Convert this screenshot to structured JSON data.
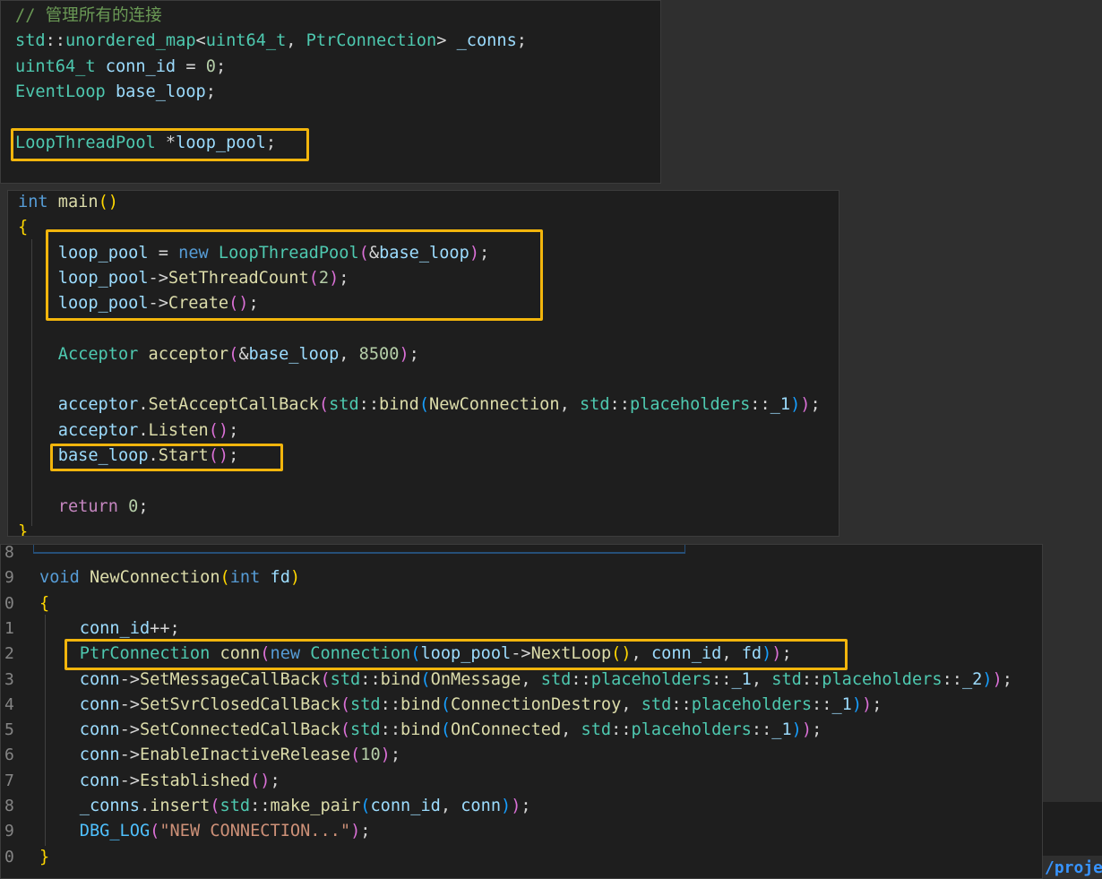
{
  "panel1": {
    "lines": [
      [
        [
          "c-comment",
          "// 管理所有的连接"
        ]
      ],
      [
        [
          "c-type",
          "std"
        ],
        [
          "c-op",
          "::"
        ],
        [
          "c-type",
          "unordered_map"
        ],
        [
          "c-op",
          "<"
        ],
        [
          "c-type",
          "uint64_t"
        ],
        [
          "c-op",
          ", "
        ],
        [
          "c-type",
          "PtrConnection"
        ],
        [
          "c-op",
          "> "
        ],
        [
          "c-var",
          "_conns"
        ],
        [
          "c-op",
          ";"
        ]
      ],
      [
        [
          "c-type",
          "uint64_t"
        ],
        [
          "c-op",
          " "
        ],
        [
          "c-var",
          "conn_id"
        ],
        [
          "c-op",
          " = "
        ],
        [
          "c-num",
          "0"
        ],
        [
          "c-op",
          ";"
        ]
      ],
      [
        [
          "c-type",
          "EventLoop"
        ],
        [
          "c-op",
          " "
        ],
        [
          "c-var",
          "base_loop"
        ],
        [
          "c-op",
          ";"
        ]
      ],
      [],
      [
        [
          "c-type",
          "LoopThreadPool"
        ],
        [
          "c-op",
          " *"
        ],
        [
          "c-var",
          "loop_pool"
        ],
        [
          "c-op",
          ";"
        ]
      ]
    ]
  },
  "panel2": {
    "lines": [
      [
        [
          "c-kw",
          "int"
        ],
        [
          "c-op",
          " "
        ],
        [
          "c-fn",
          "main"
        ],
        [
          "c-p1",
          "()"
        ]
      ],
      [
        [
          "c-p1",
          "{"
        ]
      ],
      [
        [
          "c-op",
          "    "
        ],
        [
          "c-var",
          "loop_pool"
        ],
        [
          "c-op",
          " = "
        ],
        [
          "c-kw",
          "new"
        ],
        [
          "c-op",
          " "
        ],
        [
          "c-type",
          "LoopThreadPool"
        ],
        [
          "c-p2",
          "("
        ],
        [
          "c-op",
          "&"
        ],
        [
          "c-var",
          "base_loop"
        ],
        [
          "c-p2",
          ")"
        ],
        [
          "c-op",
          ";"
        ]
      ],
      [
        [
          "c-op",
          "    "
        ],
        [
          "c-var",
          "loop_pool"
        ],
        [
          "c-op",
          "->"
        ],
        [
          "c-fn",
          "SetThreadCount"
        ],
        [
          "c-p2",
          "("
        ],
        [
          "c-num",
          "2"
        ],
        [
          "c-p2",
          ")"
        ],
        [
          "c-op",
          ";"
        ]
      ],
      [
        [
          "c-op",
          "    "
        ],
        [
          "c-var",
          "loop_pool"
        ],
        [
          "c-op",
          "->"
        ],
        [
          "c-fn",
          "Create"
        ],
        [
          "c-p2",
          "()"
        ],
        [
          "c-op",
          ";"
        ]
      ],
      [],
      [
        [
          "c-op",
          "    "
        ],
        [
          "c-type",
          "Acceptor"
        ],
        [
          "c-op",
          " "
        ],
        [
          "c-fn",
          "acceptor"
        ],
        [
          "c-p2",
          "("
        ],
        [
          "c-op",
          "&"
        ],
        [
          "c-var",
          "base_loop"
        ],
        [
          "c-op",
          ", "
        ],
        [
          "c-num",
          "8500"
        ],
        [
          "c-p2",
          ")"
        ],
        [
          "c-op",
          ";"
        ]
      ],
      [],
      [
        [
          "c-op",
          "    "
        ],
        [
          "c-var",
          "acceptor"
        ],
        [
          "c-op",
          "."
        ],
        [
          "c-fn",
          "SetAcceptCallBack"
        ],
        [
          "c-p2",
          "("
        ],
        [
          "c-type",
          "std"
        ],
        [
          "c-op",
          "::"
        ],
        [
          "c-fn",
          "bind"
        ],
        [
          "c-p3",
          "("
        ],
        [
          "c-fn",
          "NewConnection"
        ],
        [
          "c-op",
          ", "
        ],
        [
          "c-type",
          "std"
        ],
        [
          "c-op",
          "::"
        ],
        [
          "c-type",
          "placeholders"
        ],
        [
          "c-op",
          "::"
        ],
        [
          "c-var",
          "_1"
        ],
        [
          "c-p3",
          ")"
        ],
        [
          "c-p2",
          ")"
        ],
        [
          "c-op",
          ";"
        ]
      ],
      [
        [
          "c-op",
          "    "
        ],
        [
          "c-var",
          "acceptor"
        ],
        [
          "c-op",
          "."
        ],
        [
          "c-fn",
          "Listen"
        ],
        [
          "c-p2",
          "()"
        ],
        [
          "c-op",
          ";"
        ]
      ],
      [
        [
          "c-op",
          "    "
        ],
        [
          "c-var",
          "base_loop"
        ],
        [
          "c-op",
          "."
        ],
        [
          "c-fn",
          "Start"
        ],
        [
          "c-p2",
          "()"
        ],
        [
          "c-op",
          ";"
        ]
      ],
      [],
      [
        [
          "c-op",
          "    "
        ],
        [
          "c-ctl",
          "return"
        ],
        [
          "c-op",
          " "
        ],
        [
          "c-num",
          "0"
        ],
        [
          "c-op",
          ";"
        ]
      ],
      [
        [
          "c-p1",
          "}"
        ]
      ]
    ]
  },
  "panel3": {
    "gutter": [
      "8",
      "9",
      "0",
      "1",
      "2",
      "3",
      "4",
      "5",
      "6",
      "7",
      "8",
      "9",
      "0"
    ],
    "lines": [
      [],
      [
        [
          "c-kw",
          "void"
        ],
        [
          "c-op",
          " "
        ],
        [
          "c-fn",
          "NewConnection"
        ],
        [
          "c-p1",
          "("
        ],
        [
          "c-kw",
          "int"
        ],
        [
          "c-op",
          " "
        ],
        [
          "c-var",
          "fd"
        ],
        [
          "c-p1",
          ")"
        ]
      ],
      [
        [
          "c-p1",
          "{"
        ]
      ],
      [
        [
          "c-op",
          "    "
        ],
        [
          "c-var",
          "conn_id"
        ],
        [
          "c-op",
          "++;"
        ]
      ],
      [
        [
          "c-op",
          "    "
        ],
        [
          "c-type",
          "PtrConnection"
        ],
        [
          "c-op",
          " "
        ],
        [
          "c-fn",
          "conn"
        ],
        [
          "c-p2",
          "("
        ],
        [
          "c-kw",
          "new"
        ],
        [
          "c-op",
          " "
        ],
        [
          "c-type",
          "Connection"
        ],
        [
          "c-p3",
          "("
        ],
        [
          "c-var",
          "loop_pool"
        ],
        [
          "c-op",
          "->"
        ],
        [
          "c-fn",
          "NextLoop"
        ],
        [
          "c-p1",
          "()"
        ],
        [
          "c-op",
          ", "
        ],
        [
          "c-var",
          "conn_id"
        ],
        [
          "c-op",
          ", "
        ],
        [
          "c-var",
          "fd"
        ],
        [
          "c-p3",
          ")"
        ],
        [
          "c-p2",
          ")"
        ],
        [
          "c-op",
          ";"
        ]
      ],
      [
        [
          "c-op",
          "    "
        ],
        [
          "c-var",
          "conn"
        ],
        [
          "c-op",
          "->"
        ],
        [
          "c-fn",
          "SetMessageCallBack"
        ],
        [
          "c-p2",
          "("
        ],
        [
          "c-type",
          "std"
        ],
        [
          "c-op",
          "::"
        ],
        [
          "c-fn",
          "bind"
        ],
        [
          "c-p3",
          "("
        ],
        [
          "c-fn",
          "OnMessage"
        ],
        [
          "c-op",
          ", "
        ],
        [
          "c-type",
          "std"
        ],
        [
          "c-op",
          "::"
        ],
        [
          "c-type",
          "placeholders"
        ],
        [
          "c-op",
          "::"
        ],
        [
          "c-var",
          "_1"
        ],
        [
          "c-op",
          ", "
        ],
        [
          "c-type",
          "std"
        ],
        [
          "c-op",
          "::"
        ],
        [
          "c-type",
          "placeholders"
        ],
        [
          "c-op",
          "::"
        ],
        [
          "c-var",
          "_2"
        ],
        [
          "c-p3",
          ")"
        ],
        [
          "c-p2",
          ")"
        ],
        [
          "c-op",
          ";"
        ]
      ],
      [
        [
          "c-op",
          "    "
        ],
        [
          "c-var",
          "conn"
        ],
        [
          "c-op",
          "->"
        ],
        [
          "c-fn",
          "SetSvrClosedCallBack"
        ],
        [
          "c-p2",
          "("
        ],
        [
          "c-type",
          "std"
        ],
        [
          "c-op",
          "::"
        ],
        [
          "c-fn",
          "bind"
        ],
        [
          "c-p3",
          "("
        ],
        [
          "c-fn",
          "ConnectionDestroy"
        ],
        [
          "c-op",
          ", "
        ],
        [
          "c-type",
          "std"
        ],
        [
          "c-op",
          "::"
        ],
        [
          "c-type",
          "placeholders"
        ],
        [
          "c-op",
          "::"
        ],
        [
          "c-var",
          "_1"
        ],
        [
          "c-p3",
          ")"
        ],
        [
          "c-p2",
          ")"
        ],
        [
          "c-op",
          ";"
        ]
      ],
      [
        [
          "c-op",
          "    "
        ],
        [
          "c-var",
          "conn"
        ],
        [
          "c-op",
          "->"
        ],
        [
          "c-fn",
          "SetConnectedCallBack"
        ],
        [
          "c-p2",
          "("
        ],
        [
          "c-type",
          "std"
        ],
        [
          "c-op",
          "::"
        ],
        [
          "c-fn",
          "bind"
        ],
        [
          "c-p3",
          "("
        ],
        [
          "c-fn",
          "OnConnected"
        ],
        [
          "c-op",
          ", "
        ],
        [
          "c-type",
          "std"
        ],
        [
          "c-op",
          "::"
        ],
        [
          "c-type",
          "placeholders"
        ],
        [
          "c-op",
          "::"
        ],
        [
          "c-var",
          "_1"
        ],
        [
          "c-p3",
          ")"
        ],
        [
          "c-p2",
          ")"
        ],
        [
          "c-op",
          ";"
        ]
      ],
      [
        [
          "c-op",
          "    "
        ],
        [
          "c-var",
          "conn"
        ],
        [
          "c-op",
          "->"
        ],
        [
          "c-fn",
          "EnableInactiveRelease"
        ],
        [
          "c-p2",
          "("
        ],
        [
          "c-num",
          "10"
        ],
        [
          "c-p2",
          ")"
        ],
        [
          "c-op",
          ";"
        ]
      ],
      [
        [
          "c-op",
          "    "
        ],
        [
          "c-var",
          "conn"
        ],
        [
          "c-op",
          "->"
        ],
        [
          "c-fn",
          "Established"
        ],
        [
          "c-p2",
          "()"
        ],
        [
          "c-op",
          ";"
        ]
      ],
      [
        [
          "c-op",
          "    "
        ],
        [
          "c-var",
          "_conns"
        ],
        [
          "c-op",
          "."
        ],
        [
          "c-fn",
          "insert"
        ],
        [
          "c-p2",
          "("
        ],
        [
          "c-type",
          "std"
        ],
        [
          "c-op",
          "::"
        ],
        [
          "c-fn",
          "make_pair"
        ],
        [
          "c-p3",
          "("
        ],
        [
          "c-var",
          "conn_id"
        ],
        [
          "c-op",
          ", "
        ],
        [
          "c-var",
          "conn"
        ],
        [
          "c-p3",
          ")"
        ],
        [
          "c-p2",
          ")"
        ],
        [
          "c-op",
          ";"
        ]
      ],
      [
        [
          "c-op",
          "    "
        ],
        [
          "c-macro",
          "DBG_LOG"
        ],
        [
          "c-p2",
          "("
        ],
        [
          "c-str",
          "\"NEW CONNECTION...\""
        ],
        [
          "c-p2",
          ")"
        ],
        [
          "c-op",
          ";"
        ]
      ],
      [
        [
          "c-p1",
          "}"
        ]
      ]
    ]
  },
  "footer": {
    "path": "/proje"
  }
}
